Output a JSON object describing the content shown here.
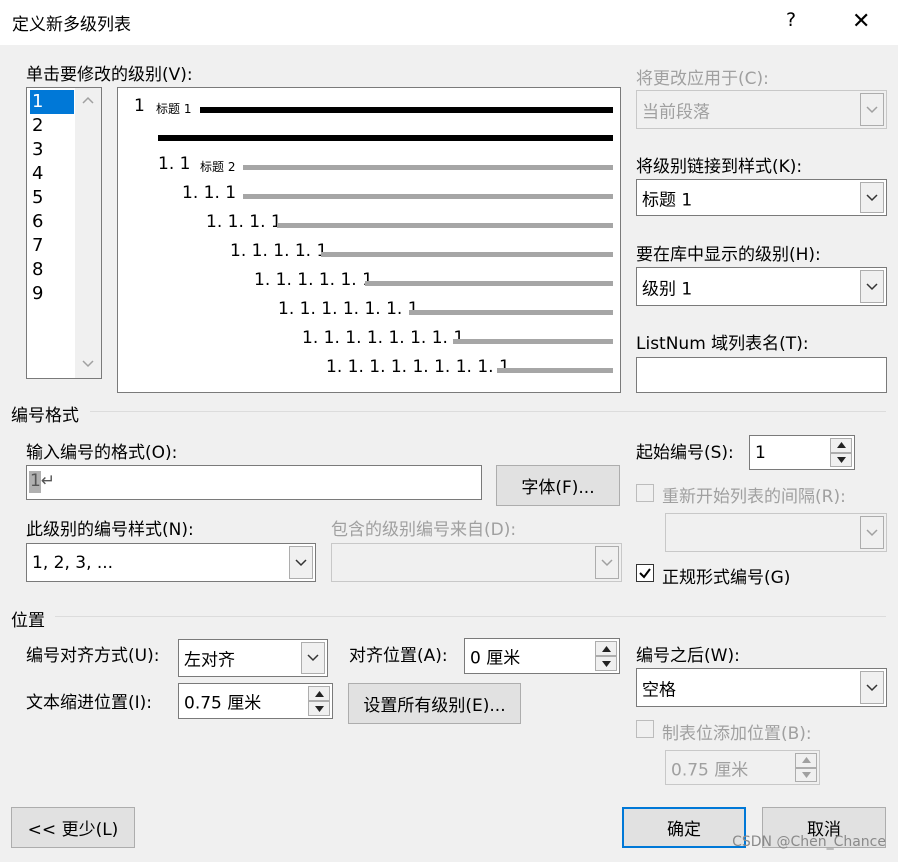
{
  "window": {
    "title": "定义新多级列表",
    "help": "?",
    "close": "✕"
  },
  "level_section": {
    "label": "单击要修改的级别(V):",
    "levels": [
      "1",
      "2",
      "3",
      "4",
      "5",
      "6",
      "7",
      "8",
      "9"
    ],
    "selected": "1"
  },
  "preview": {
    "lines": [
      {
        "num": "1",
        "tag": "标题 1"
      },
      {
        "num": "1. 1",
        "tag": "标题 2"
      },
      {
        "num": "1. 1. 1",
        "tag": ""
      },
      {
        "num": "1. 1. 1. 1",
        "tag": ""
      },
      {
        "num": "1. 1. 1. 1. 1",
        "tag": ""
      },
      {
        "num": "1. 1. 1. 1. 1. 1",
        "tag": ""
      },
      {
        "num": "1. 1. 1. 1. 1. 1. 1",
        "tag": ""
      },
      {
        "num": "1. 1. 1. 1. 1. 1. 1. 1",
        "tag": ""
      },
      {
        "num": "1. 1. 1. 1. 1. 1. 1. 1. 1",
        "tag": ""
      }
    ]
  },
  "right_panel": {
    "apply_to_label": "将更改应用于(C):",
    "apply_to_value": "当前段落",
    "link_style_label": "将级别链接到样式(K):",
    "link_style_value": "标题 1",
    "gallery_level_label": "要在库中显示的级别(H):",
    "gallery_level_value": "级别 1",
    "listnum_label": "ListNum 域列表名(T):",
    "listnum_value": ""
  },
  "number_format": {
    "group_label": "编号格式",
    "format_label": "输入编号的格式(O):",
    "format_value": "1↵",
    "font_button": "字体(F)...",
    "style_label": "此级别的编号样式(N):",
    "style_value": "1, 2, 3, ...",
    "include_label": "包含的级别编号来自(D):",
    "include_value": "",
    "start_label": "起始编号(S):",
    "start_value": "1",
    "restart_label": "重新开始列表的间隔(R):",
    "restart_value": "",
    "legal_label": "正规形式编号(G)",
    "legal_checked": true
  },
  "position": {
    "group_label": "位置",
    "align_label": "编号对齐方式(U):",
    "align_value": "左对齐",
    "align_at_label": "对齐位置(A):",
    "align_at_value": "0 厘米",
    "indent_label": "文本缩进位置(I):",
    "indent_value": "0.75 厘米",
    "set_all_button": "设置所有级别(E)...",
    "follow_label": "编号之后(W):",
    "follow_value": "空格",
    "tab_label": "制表位添加位置(B):",
    "tab_value": "0.75 厘米"
  },
  "footer": {
    "less_button": "<< 更少(L)",
    "ok_button": "确定",
    "cancel_button": "取消",
    "watermark": "CSDN @Chen_Chance"
  },
  "colors": {
    "selection": "#0078d7",
    "default_border": "#0078d7"
  }
}
